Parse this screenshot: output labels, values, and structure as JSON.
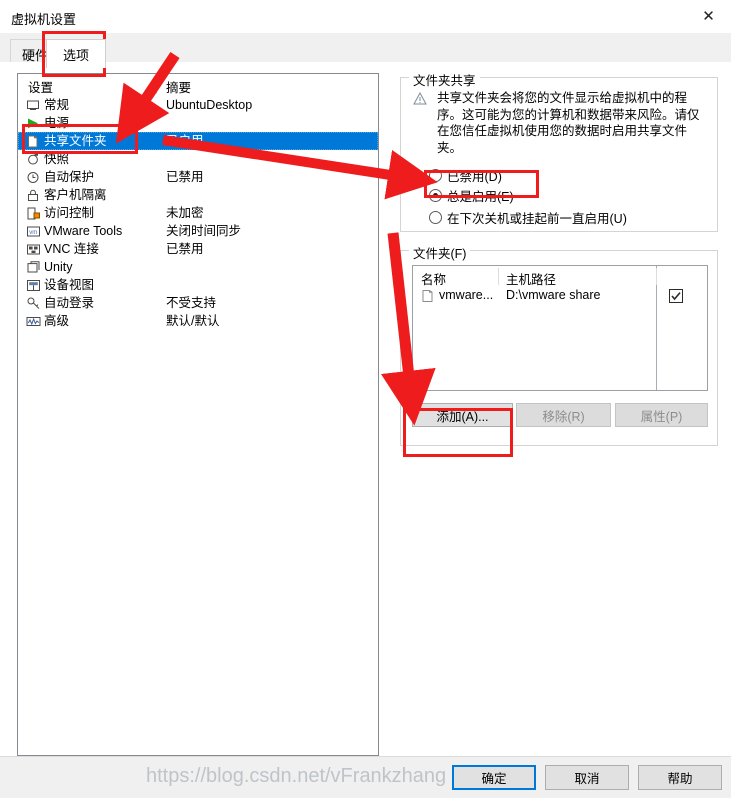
{
  "window": {
    "title": "虚拟机设置",
    "close_icon": "close-icon"
  },
  "tabs": [
    {
      "label": "硬件",
      "selected": false
    },
    {
      "label": "选项",
      "selected": true
    }
  ],
  "settings_list": {
    "columns": {
      "setting": "设置",
      "summary": "摘要"
    },
    "rows": [
      {
        "icon": "monitor-icon",
        "label": "常规",
        "summary": "UbuntuDesktop",
        "selected": false
      },
      {
        "icon": "play-icon",
        "label": "电源",
        "summary": "",
        "selected": false
      },
      {
        "icon": "folder-icon",
        "label": "共享文件夹",
        "summary": "已启用",
        "selected": true
      },
      {
        "icon": "camera-icon",
        "label": "快照",
        "summary": "",
        "selected": false
      },
      {
        "icon": "clock-icon",
        "label": "自动保护",
        "summary": "已禁用",
        "selected": false
      },
      {
        "icon": "lock-icon",
        "label": "客户机隔离",
        "summary": "",
        "selected": false
      },
      {
        "icon": "shield-lock-icon",
        "label": "访问控制",
        "summary": "未加密",
        "selected": false
      },
      {
        "icon": "vmware-tools-icon",
        "label": "VMware Tools",
        "summary": "关闭时间同步",
        "selected": false
      },
      {
        "icon": "vnc-icon",
        "label": "VNC 连接",
        "summary": "已禁用",
        "selected": false
      },
      {
        "icon": "unity-icon",
        "label": "Unity",
        "summary": "",
        "selected": false
      },
      {
        "icon": "device-view-icon",
        "label": "设备视图",
        "summary": "",
        "selected": false
      },
      {
        "icon": "autologin-icon",
        "label": "自动登录",
        "summary": "不受支持",
        "selected": false
      },
      {
        "icon": "advanced-icon",
        "label": "高级",
        "summary": "默认/默认",
        "selected": false
      }
    ]
  },
  "folder_sharing": {
    "group_title": "文件夹共享",
    "warning_icon": "warning-icon",
    "warning_text": "共享文件夹会将您的文件显示给虚拟机中的程序。这可能为您的计算机和数据带来风险。请仅在您信任虚拟机使用您的数据时启用共享文件夹。",
    "options": [
      {
        "label": "已禁用(D)",
        "selected": false
      },
      {
        "label": "总是启用(E)",
        "selected": true
      },
      {
        "label": "在下次关机或挂起前一直启用(U)",
        "selected": false
      }
    ]
  },
  "folders": {
    "group_title": "文件夹(F)",
    "columns": [
      "名称",
      "主机路径"
    ],
    "rows": [
      {
        "icon": "folder-icon",
        "name": "vmware...",
        "path": "D:\\vmware share",
        "enabled": true
      }
    ],
    "buttons": [
      {
        "id": "add",
        "label": "添加(A)...",
        "disabled": false
      },
      {
        "id": "remove",
        "label": "移除(R)",
        "disabled": true
      },
      {
        "id": "props",
        "label": "属性(P)",
        "disabled": true
      }
    ]
  },
  "footer": {
    "ok": "确定",
    "cancel": "取消",
    "help": "帮助"
  },
  "watermark": "https://blog.csdn.net/vFrankzhang",
  "colors": {
    "selection_blue": "#0078d7",
    "annotation_red": "#ee1c1c",
    "button_face": "#e1e1e1",
    "panel_bg": "#f0f0f0"
  }
}
